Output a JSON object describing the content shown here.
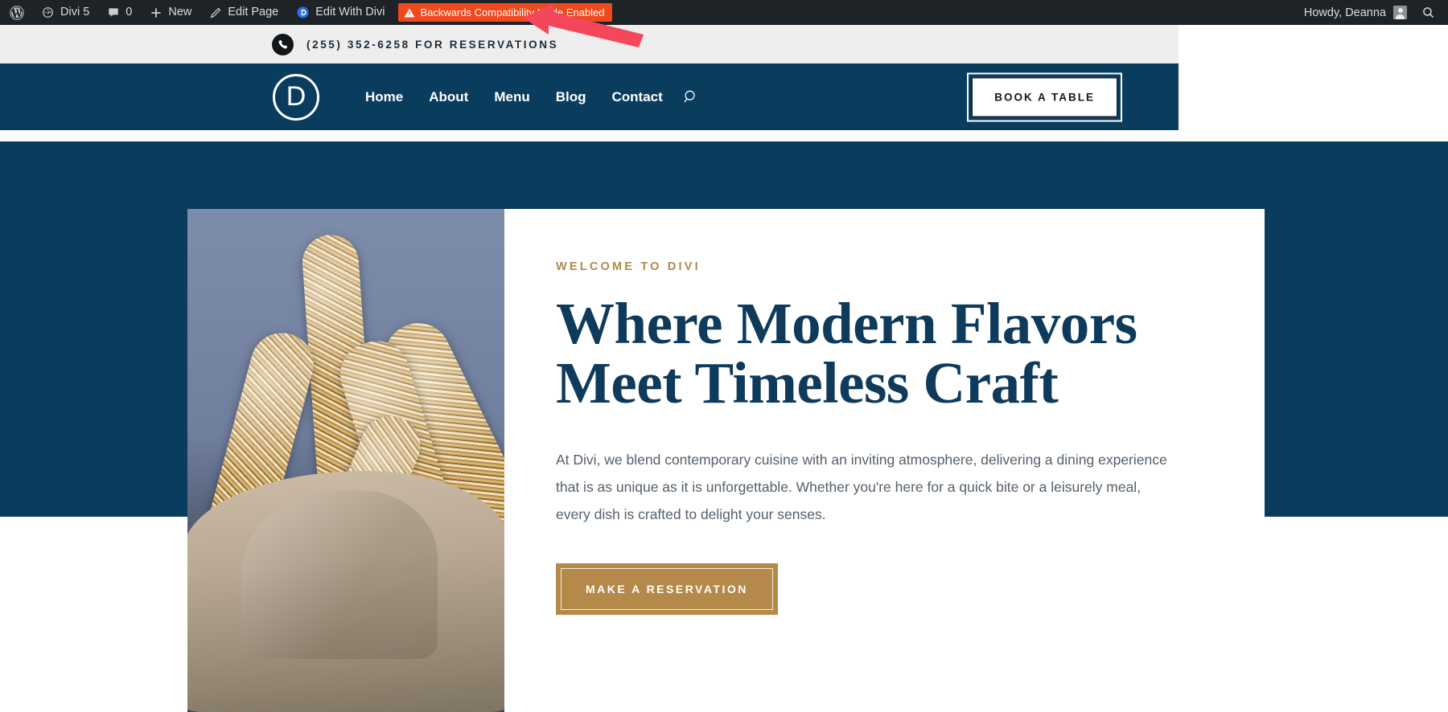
{
  "adminbar": {
    "items": [
      {
        "icon": "wordpress-logo-icon",
        "label": ""
      },
      {
        "icon": "dashboard-speedometer-icon",
        "label": "Divi 5"
      },
      {
        "icon": "comment-bubble-icon",
        "label": "0"
      },
      {
        "icon": "plus-icon",
        "label": "New"
      },
      {
        "icon": "pencil-icon",
        "label": "Edit Page"
      },
      {
        "icon": "divi-d-icon",
        "label": "Edit With Divi"
      }
    ],
    "badge": {
      "icon": "warning-triangle-icon",
      "label": "Backwards Compatibility Mode Enabled",
      "color": "#f0491d"
    },
    "howdy": "Howdy, Deanna",
    "avatar_icon": "user-avatar-icon",
    "search_icon": "search-icon"
  },
  "topbar": {
    "phone_icon": "phone-icon",
    "phone_text": "(255) 352-6258 FOR RESERVATIONS"
  },
  "nav": {
    "logo_letter": "D",
    "logo_icon": "divi-circle-logo-icon",
    "links": [
      {
        "label": "Home"
      },
      {
        "label": "About"
      },
      {
        "label": "Menu"
      },
      {
        "label": "Blog"
      },
      {
        "label": "Contact"
      }
    ],
    "search_icon": "search-icon",
    "cta_label": "BOOK A TABLE",
    "bg_color": "#0a3c5e"
  },
  "hero": {
    "eyebrow": "WELCOME TO DIVI",
    "eyebrow_color": "#b08a4c",
    "title_line1": "Where Modern Flavors",
    "title_line2": "Meet Timeless Craft",
    "title_color": "#0e3a5c",
    "paragraph": "At Divi, we blend contemporary cuisine with an inviting atmosphere, delivering a dining experience that is as unique as it is unforgettable. Whether you're here for a quick bite or a leisurely meal, every dish is crafted to delight your senses.",
    "cta_label": "MAKE A RESERVATION",
    "cta_color": "#b4894a",
    "image_alt": "seeded-breadsticks-photo"
  },
  "annotation": {
    "arrow_icon": "red-arrow-pointing-left",
    "arrow_color": "#f4475c"
  }
}
